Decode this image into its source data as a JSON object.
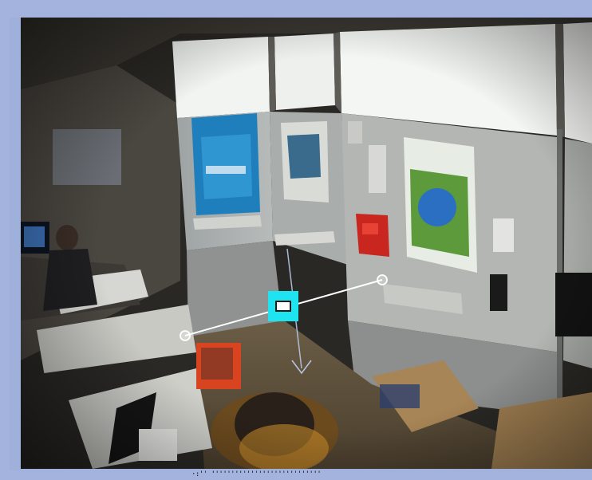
{
  "viewer": {
    "background_color": "#a3b3dd",
    "overlay_line_color": "#ffffff",
    "center_handle_color": "#1ee3f0"
  },
  "camera_feed": {
    "description_icon": "camera-view",
    "footer_caption": "·:'' ''''''''''''''''''''''''''''"
  },
  "line_tool": {
    "start_handle_icon": "circle-handle-icon",
    "end_handle_icon": "circle-handle-icon",
    "center_handle_icon": "square-handle-icon",
    "direction_arrow_icon": "arrow-down-icon"
  }
}
